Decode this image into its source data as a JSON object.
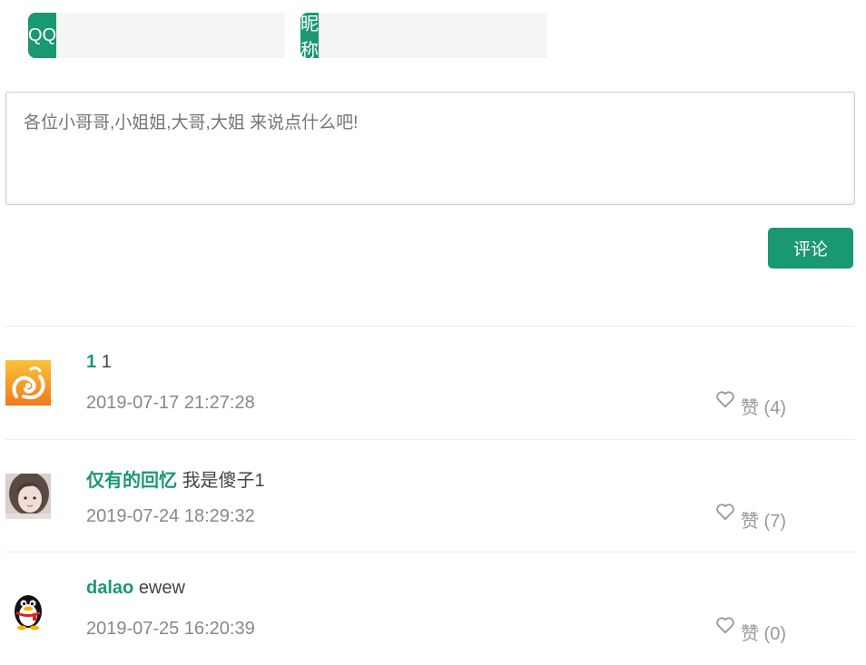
{
  "form": {
    "qq_label": "QQ",
    "qq_value": "",
    "nickname_label": "昵称",
    "nickname_value": "",
    "comment_placeholder": "各位小哥哥,小姐姐,大哥,大姐 来说点什么吧!",
    "submit_label": "评论"
  },
  "comments": [
    {
      "author": "1",
      "text": "1",
      "time": "2019-07-17 21:27:28",
      "like_label": "赞 (4)",
      "avatar_icon": "uc-browser-squirrel-avatar"
    },
    {
      "author": "仅有的回忆",
      "text": "我是傻子1",
      "time": "2019-07-24 18:29:32",
      "like_label": "赞 (7)",
      "avatar_icon": "girl-photo-avatar"
    },
    {
      "author": "dalao",
      "text": "ewew",
      "time": "2019-07-25 16:20:39",
      "like_label": "赞 (0)",
      "avatar_icon": "qq-penguin-avatar"
    }
  ],
  "colors": {
    "accent": "#1a9872",
    "muted": "#888888"
  }
}
